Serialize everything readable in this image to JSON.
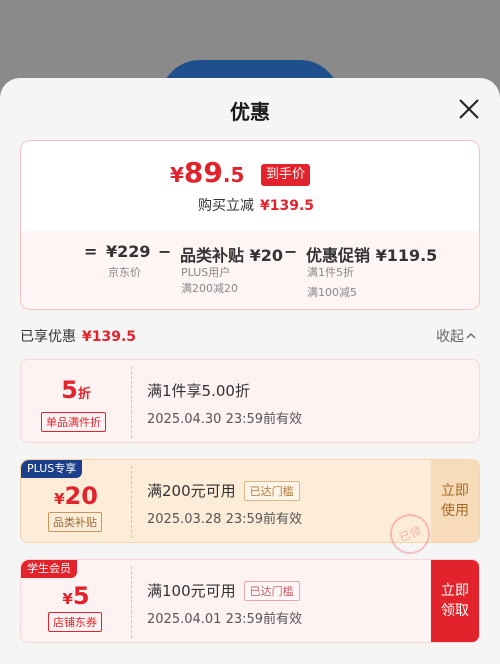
{
  "sheet": {
    "title": "优惠"
  },
  "summary": {
    "price_yen": "¥",
    "price_int": "89",
    "price_dec": ".5",
    "price_tag": "到手价",
    "reduce_label": "购买立减",
    "reduce_amount": "¥139.5"
  },
  "formula": {
    "equals": "=",
    "base_price": "¥229",
    "base_label": "京东价",
    "minus1": "−",
    "subsidy_title": "品类补贴 ¥20",
    "subsidy_sub1": "PLUS用户",
    "subsidy_sub2": "满200减20",
    "minus2": "−",
    "promo_title": "优惠促销 ¥119.5",
    "promo_sub1": "满1件5折",
    "promo_sub2": "满100减5"
  },
  "enjoyed": {
    "label": "已享优惠",
    "amount": "¥139.5",
    "collapse": "收起"
  },
  "coupons": [
    {
      "value_main": "5",
      "value_unit": "折",
      "tag": "单品满件折",
      "title": "满1件享5.00折",
      "expire": "2025.04.30 23:59前有效"
    },
    {
      "badge": "PLUS专享",
      "value_yen": "¥",
      "value_main": "20",
      "tag": "品类补贴",
      "title": "满200元可用",
      "reached": "已达门槛",
      "expire": "2025.03.28 23:59前有效",
      "action": "立即使用",
      "stamp": "已领"
    },
    {
      "badge": "学生会员",
      "value_yen": "¥",
      "value_main": "5",
      "tag": "店铺东券",
      "title": "满100元可用",
      "reached": "已达门槛",
      "expire": "2025.04.01 23:59前有效",
      "action": "立即领取"
    }
  ],
  "colors": {
    "accent": "#e3232c",
    "plus_bg": "#fdecd8",
    "plus_badge": "#1c3f8c",
    "student_badge": "#e3232c"
  }
}
